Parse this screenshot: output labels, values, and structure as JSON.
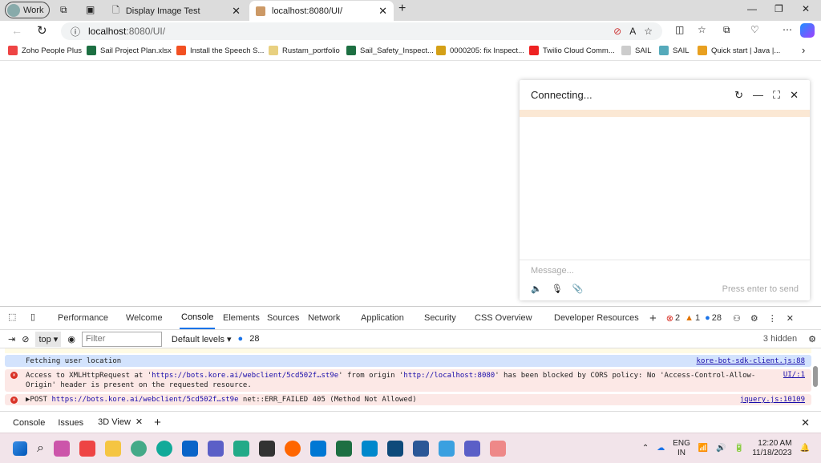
{
  "browser": {
    "profile": "Work",
    "tabs": [
      {
        "title": "Display Image Test",
        "active": false
      },
      {
        "title": "localhost:8080/UI/",
        "active": true
      }
    ],
    "url_host": "localhost",
    "url_rest": ":8080/UI/",
    "bookmarks": [
      {
        "label": "Zoho People Plus",
        "color": "#e44"
      },
      {
        "label": "Sail Project Plan.xlsx",
        "color": "#1d6f42"
      },
      {
        "label": "Install the Speech S...",
        "color": "#f25022"
      },
      {
        "label": "Rustam_portfolio",
        "color": "#e8d080"
      },
      {
        "label": "Sail_Safety_Inspect...",
        "color": "#1d6f42"
      },
      {
        "label": "0000205: fix Inspect...",
        "color": "#d4a017"
      },
      {
        "label": "Twilio Cloud Comm...",
        "color": "#e22"
      },
      {
        "label": "SAIL",
        "color": "#ccc"
      },
      {
        "label": "SAIL",
        "color": "#5ab"
      },
      {
        "label": "Quick start | Java |...",
        "color": "#e8a020"
      }
    ]
  },
  "chat": {
    "status": "Connecting...",
    "placeholder": "Message...",
    "hint": "Press enter to send"
  },
  "devtools": {
    "tabs": [
      "Performance",
      "Welcome",
      "Console",
      "Elements",
      "Sources",
      "Network",
      "Application",
      "Security",
      "CSS Overview",
      "Developer Resources"
    ],
    "active_tab": "Console",
    "errors": "2",
    "warnings": "1",
    "infos": "28",
    "context": "top",
    "filter_placeholder": "Filter",
    "levels": "Default levels",
    "msg_count": "28",
    "hidden": "3 hidden",
    "messages": [
      {
        "type": "info",
        "parts": [
          "Fetching user location"
        ],
        "source": "kore-bot-sdk-client.js:88"
      },
      {
        "type": "error",
        "pre": "Access to XMLHttpRequest at '",
        "link1": "https://bots.kore.ai/webclient/5cd502f…st9e",
        "mid": "' from origin '",
        "link2": "http://localhost:8080",
        "post": "' has been blocked by CORS policy: No 'Access-Control-Allow-Origin' header is present on the requested resource.",
        "source": "UI/:1"
      },
      {
        "type": "error",
        "pre": "▶POST ",
        "link1": "https://bots.kore.ai/webclient/5cd502f…st9e",
        "post": " net::ERR_FAILED 405 (Method Not Allowed)",
        "source": "jquery.js:10109"
      }
    ],
    "drawer_tabs": [
      "Console",
      "Issues",
      "3D View"
    ]
  },
  "taskbar": {
    "lang1": "ENG",
    "lang2": "IN",
    "time": "12:20 AM",
    "date": "11/18/2023"
  }
}
